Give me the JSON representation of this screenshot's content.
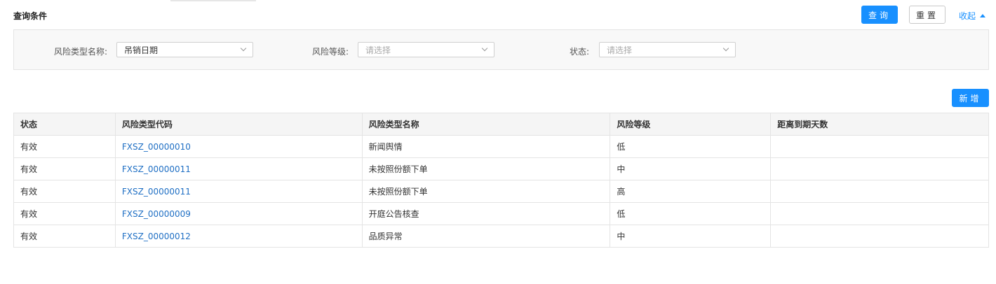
{
  "header": {
    "title": "查询条件",
    "query_label": "查询",
    "reset_label": "重置",
    "collapse_label": "收起"
  },
  "filters": {
    "risk_type_name": {
      "label": "风险类型名称:",
      "value": "吊销日期"
    },
    "risk_level": {
      "label": "风险等级:",
      "placeholder": "请选择"
    },
    "status": {
      "label": "状态:",
      "placeholder": "请选择"
    }
  },
  "actions": {
    "add_label": "新增"
  },
  "table": {
    "columns": [
      "状态",
      "风险类型代码",
      "风险类型名称",
      "风险等级",
      "距离到期天数"
    ],
    "rows": [
      [
        "有效",
        "FXSZ_00000010",
        "新闻舆情",
        "低",
        ""
      ],
      [
        "有效",
        "FXSZ_00000011",
        "未按照份额下单",
        "中",
        ""
      ],
      [
        "有效",
        "FXSZ_00000011",
        "未按照份额下单",
        "高",
        ""
      ],
      [
        "有效",
        "FXSZ_00000009",
        "开庭公告核查",
        "低",
        ""
      ],
      [
        "有效",
        "FXSZ_00000012",
        "品质异常",
        "中",
        ""
      ]
    ]
  },
  "colors": {
    "primary": "#1890ff",
    "link": "#1f6fc4"
  }
}
